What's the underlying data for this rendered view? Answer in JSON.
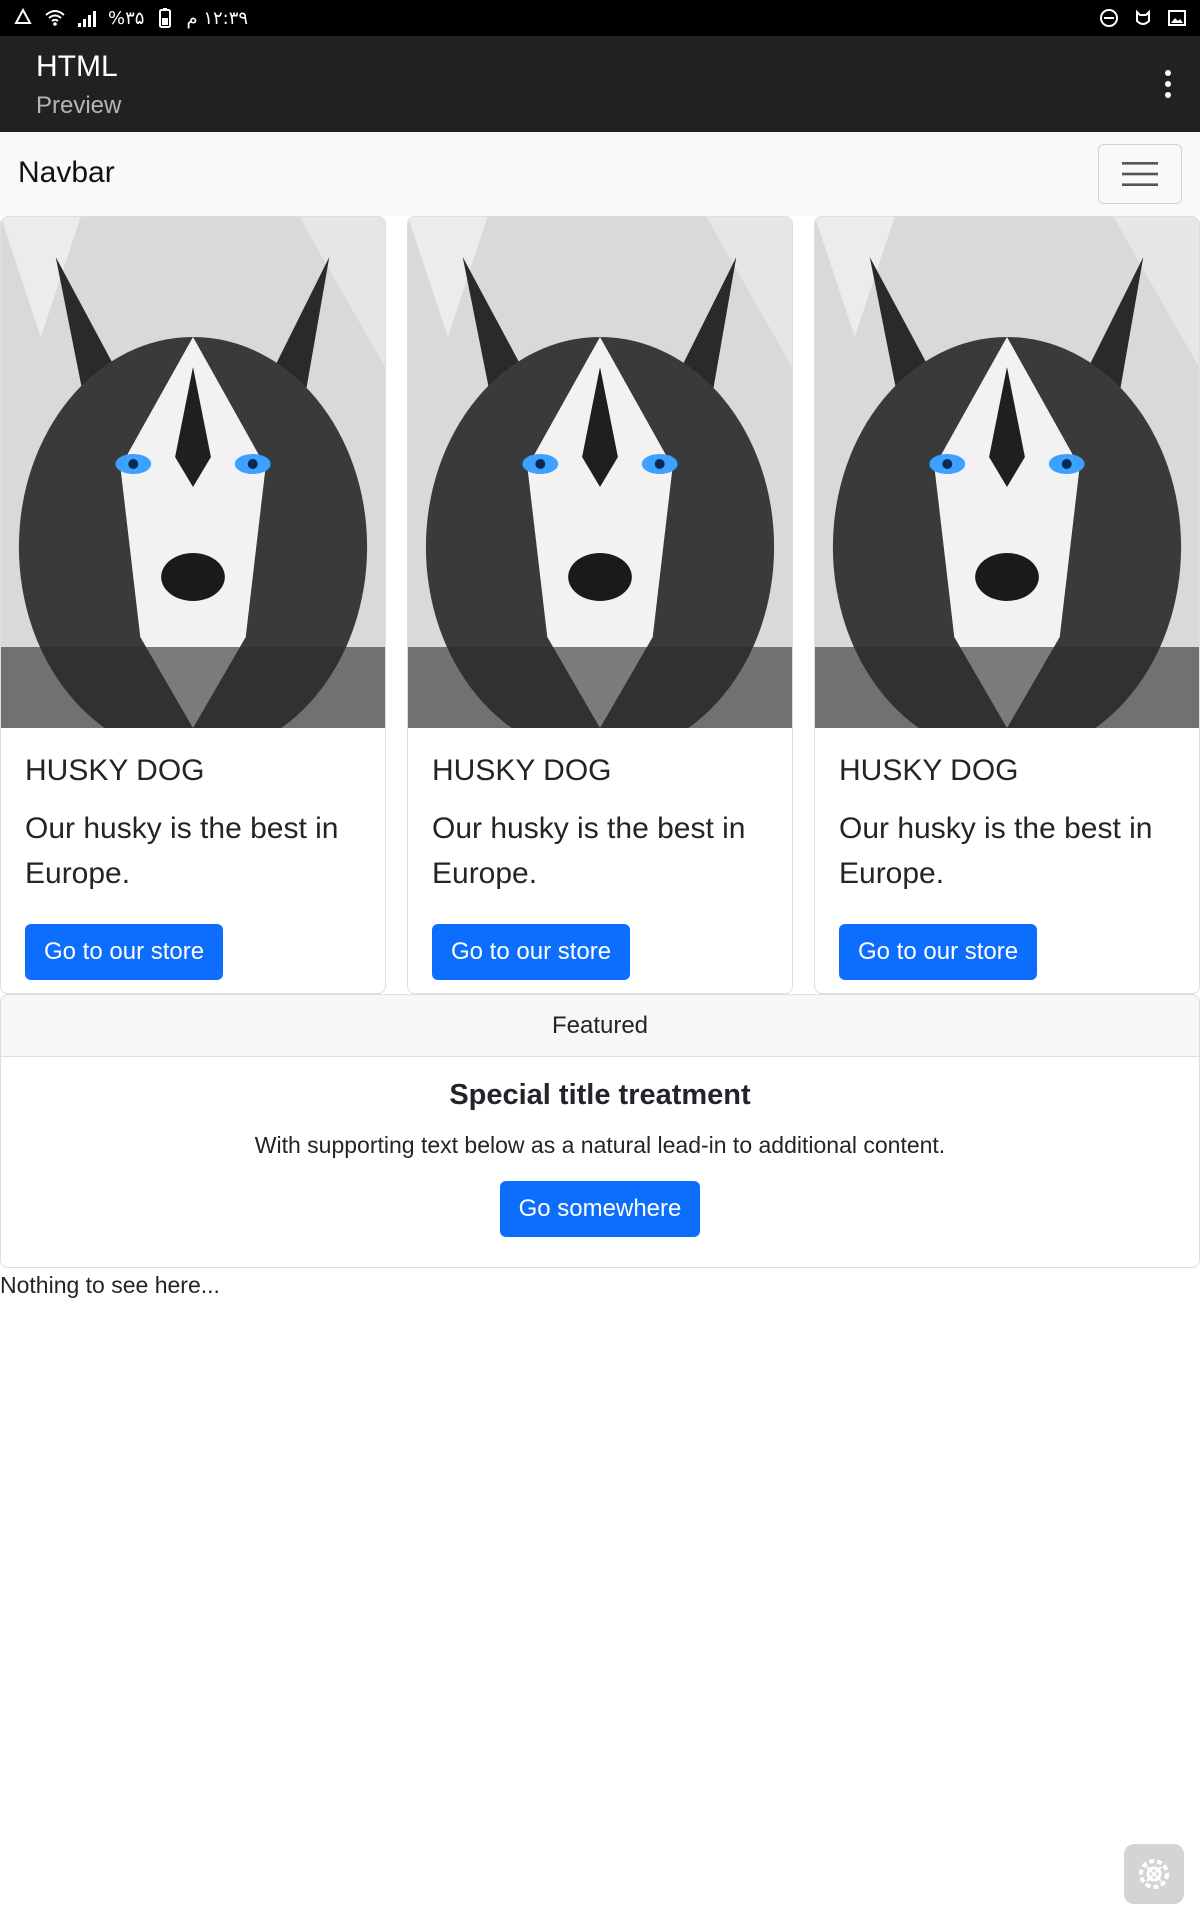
{
  "status_bar": {
    "time": "۱۲:۳۹ م",
    "battery": "%۳۵",
    "left_icons": [
      "battery-icon",
      "signal-icon",
      "wifi-icon",
      "recycle-icon"
    ],
    "right_icons": [
      "do-not-disturb-icon",
      "notification-icon",
      "image-icon"
    ]
  },
  "app_bar": {
    "title": "HTML",
    "subtitle": "Preview"
  },
  "navbar": {
    "brand": "Navbar"
  },
  "cards": [
    {
      "title": "HUSKY DOG",
      "text": "Our husky is the best in Europe.",
      "button": "Go to our store"
    },
    {
      "title": "HUSKY DOG",
      "text": "Our husky is the best in Europe.",
      "button": "Go to our store"
    },
    {
      "title": "HUSKY DOG",
      "text": "Our husky is the best in Europe.",
      "button": "Go to our store"
    }
  ],
  "featured": {
    "header": "Featured",
    "title": "Special title treatment",
    "text": "With supporting text below as a natural lead-in to additional content.",
    "button": "Go somewhere"
  },
  "footer_text": "Nothing to see here...",
  "colors": {
    "primary": "#0d6efd",
    "app_bar": "#212121",
    "navbar_bg": "#f8f9fa"
  }
}
